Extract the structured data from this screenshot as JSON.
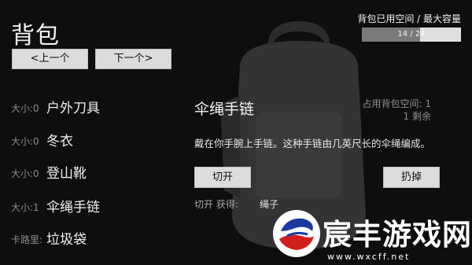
{
  "header": {
    "title": "背包",
    "prev_label": "<上一个",
    "next_label": "下一个>"
  },
  "capacity": {
    "label": "背包已用空间 / 最大容量",
    "text": "14 / 24",
    "used": 14,
    "max": 24
  },
  "items": [
    {
      "size": "大小:0",
      "name": "户外刀具"
    },
    {
      "size": "大小:0",
      "name": "冬衣"
    },
    {
      "size": "大小:0",
      "name": "登山靴"
    },
    {
      "size": "大小:1",
      "name": "伞绳手链"
    },
    {
      "size": "卡路里:",
      "name": "垃圾袋"
    }
  ],
  "detail": {
    "title": "伞绳手链",
    "space_line1": "占用背包空间: 1",
    "space_line2": "1 剩余",
    "description": "戴在你手腕上手链。这种手链由几英尺长的伞绳编成。",
    "cut_label": "切开",
    "drop_label": "扔掉",
    "yield_label": "切开 获得:",
    "yield_item": "绳子"
  },
  "watermark": {
    "text": "宸丰游戏网",
    "url": "www.wxcff.net"
  }
}
